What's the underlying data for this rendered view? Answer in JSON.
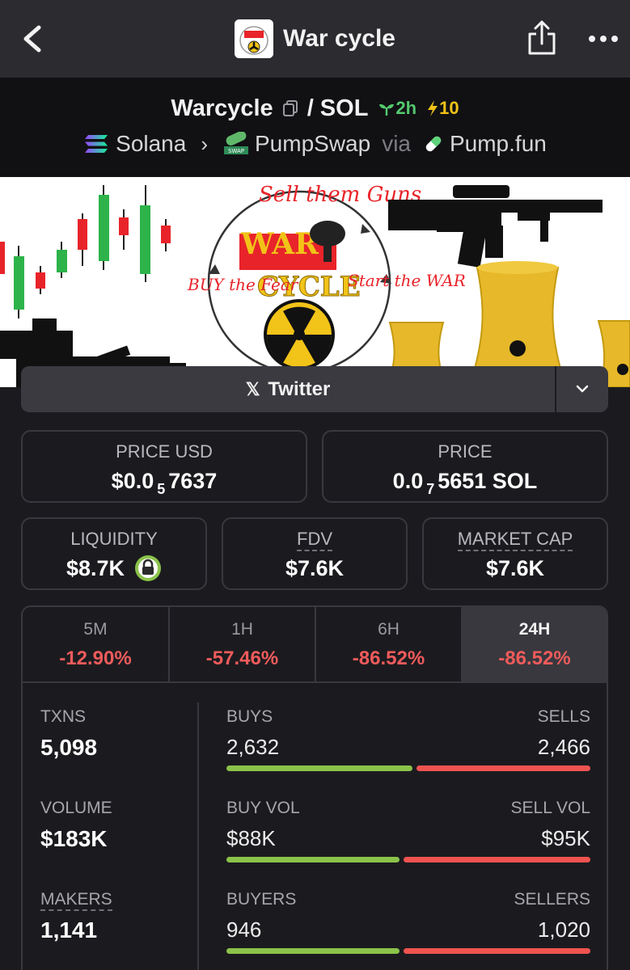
{
  "app": {
    "title": "War cycle"
  },
  "pair": {
    "base": "Warcycle",
    "quote": "/ SOL",
    "age": "2h",
    "boosts": "10",
    "chain": "Solana",
    "dex": "PumpSwap",
    "via_label": "via",
    "launchpad": "Pump.fun"
  },
  "banner": {
    "text_sell": "Sell them Guns",
    "text_war": "WAR",
    "text_cycle": "CYCLE",
    "text_buy": "BUY the Fear",
    "text_start": "Start the WAR"
  },
  "social": {
    "label": "Twitter",
    "icon": "x-logo-icon"
  },
  "price_usd": {
    "label": "PRICE USD",
    "prefix": "$0.0",
    "zeros": "5",
    "digits": "7637"
  },
  "price_native": {
    "label": "PRICE",
    "prefix": "0.0",
    "zeros": "7",
    "digits": "5651 SOL"
  },
  "liquidity": {
    "label": "LIQUIDITY",
    "value": "$8.7K"
  },
  "fdv": {
    "label": "FDV",
    "value": "$7.6K"
  },
  "market_cap": {
    "label": "MARKET CAP",
    "value": "$7.6K"
  },
  "timeframes": [
    {
      "label": "5M",
      "change": "-12.90%"
    },
    {
      "label": "1H",
      "change": "-57.46%"
    },
    {
      "label": "6H",
      "change": "-86.52%"
    },
    {
      "label": "24H",
      "change": "-86.52%",
      "active": true
    }
  ],
  "stats": {
    "txns": {
      "label": "TXNS",
      "value": "5,098",
      "buys_label": "BUYS",
      "buys": "2,632",
      "sells_label": "SELLS",
      "sells": "2,466",
      "buy_share": 0.516
    },
    "volume": {
      "label": "VOLUME",
      "value": "$183K",
      "buys_label": "BUY VOL",
      "buys": "$88K",
      "sells_label": "SELL VOL",
      "sells": "$95K",
      "buy_share": 0.481
    },
    "makers": {
      "label": "MAKERS",
      "value": "1,141",
      "buys_label": "BUYERS",
      "buys": "946",
      "sells_label": "SELLERS",
      "sells": "1,020",
      "buy_share": 0.481
    }
  },
  "colors": {
    "positive": "#8bc34a",
    "negative": "#ef5350",
    "age_green": "#54c96e",
    "boost_yellow": "#f2c318"
  }
}
